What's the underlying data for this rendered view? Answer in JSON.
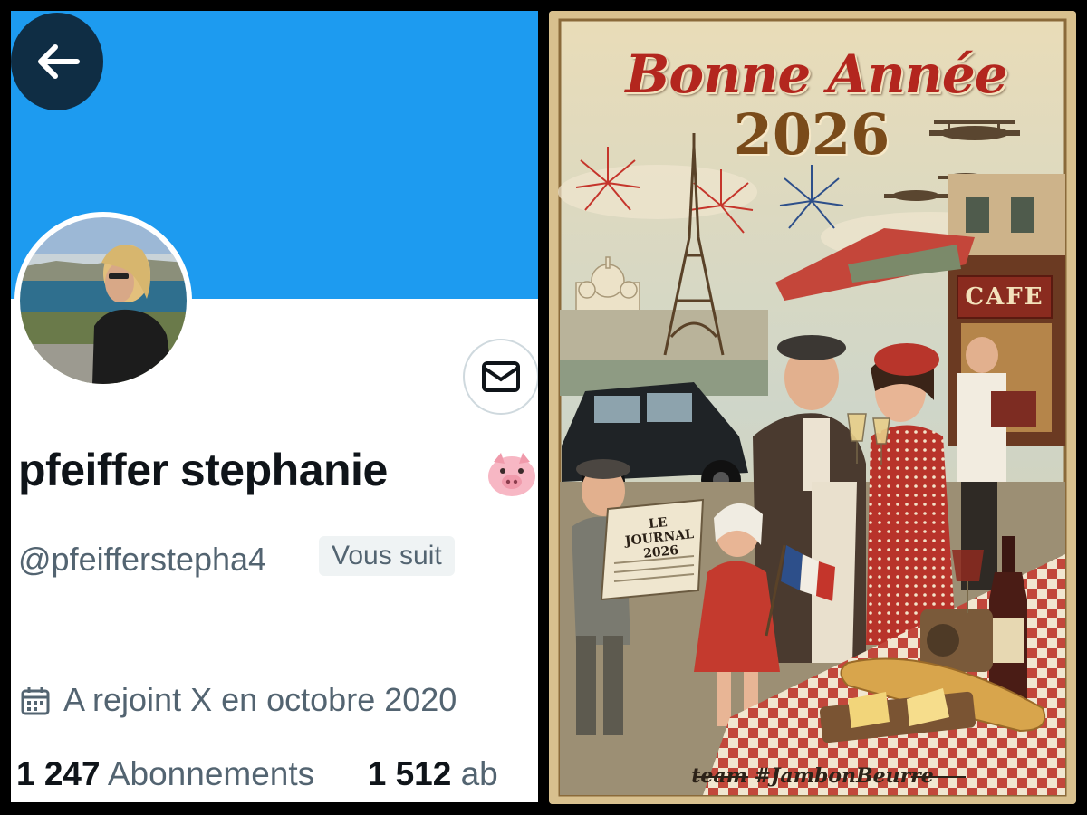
{
  "profile": {
    "display_name": "pfeiffer stephanie",
    "name_emoji": "pig-face-icon",
    "handle": "@pfeifferstepha4",
    "follows_you_badge": "Vous suit",
    "joined": "A rejoint X en octobre 2020",
    "following_count": "1 247",
    "following_label": "Abonnements",
    "followers_count": "1 512",
    "followers_label_partial": "ab",
    "banner_color": "#1d9bf0",
    "icons": [
      "arrow-left-icon",
      "envelope-icon",
      "calendar-icon"
    ]
  },
  "poster": {
    "title": "Bonne Année",
    "year": "2026",
    "cafe_sign": "CAFE",
    "journal_title": "LE JOURNAL",
    "journal_year": "2026",
    "footer": "team #JambonBeurre",
    "accent_color": "#b3261e"
  }
}
